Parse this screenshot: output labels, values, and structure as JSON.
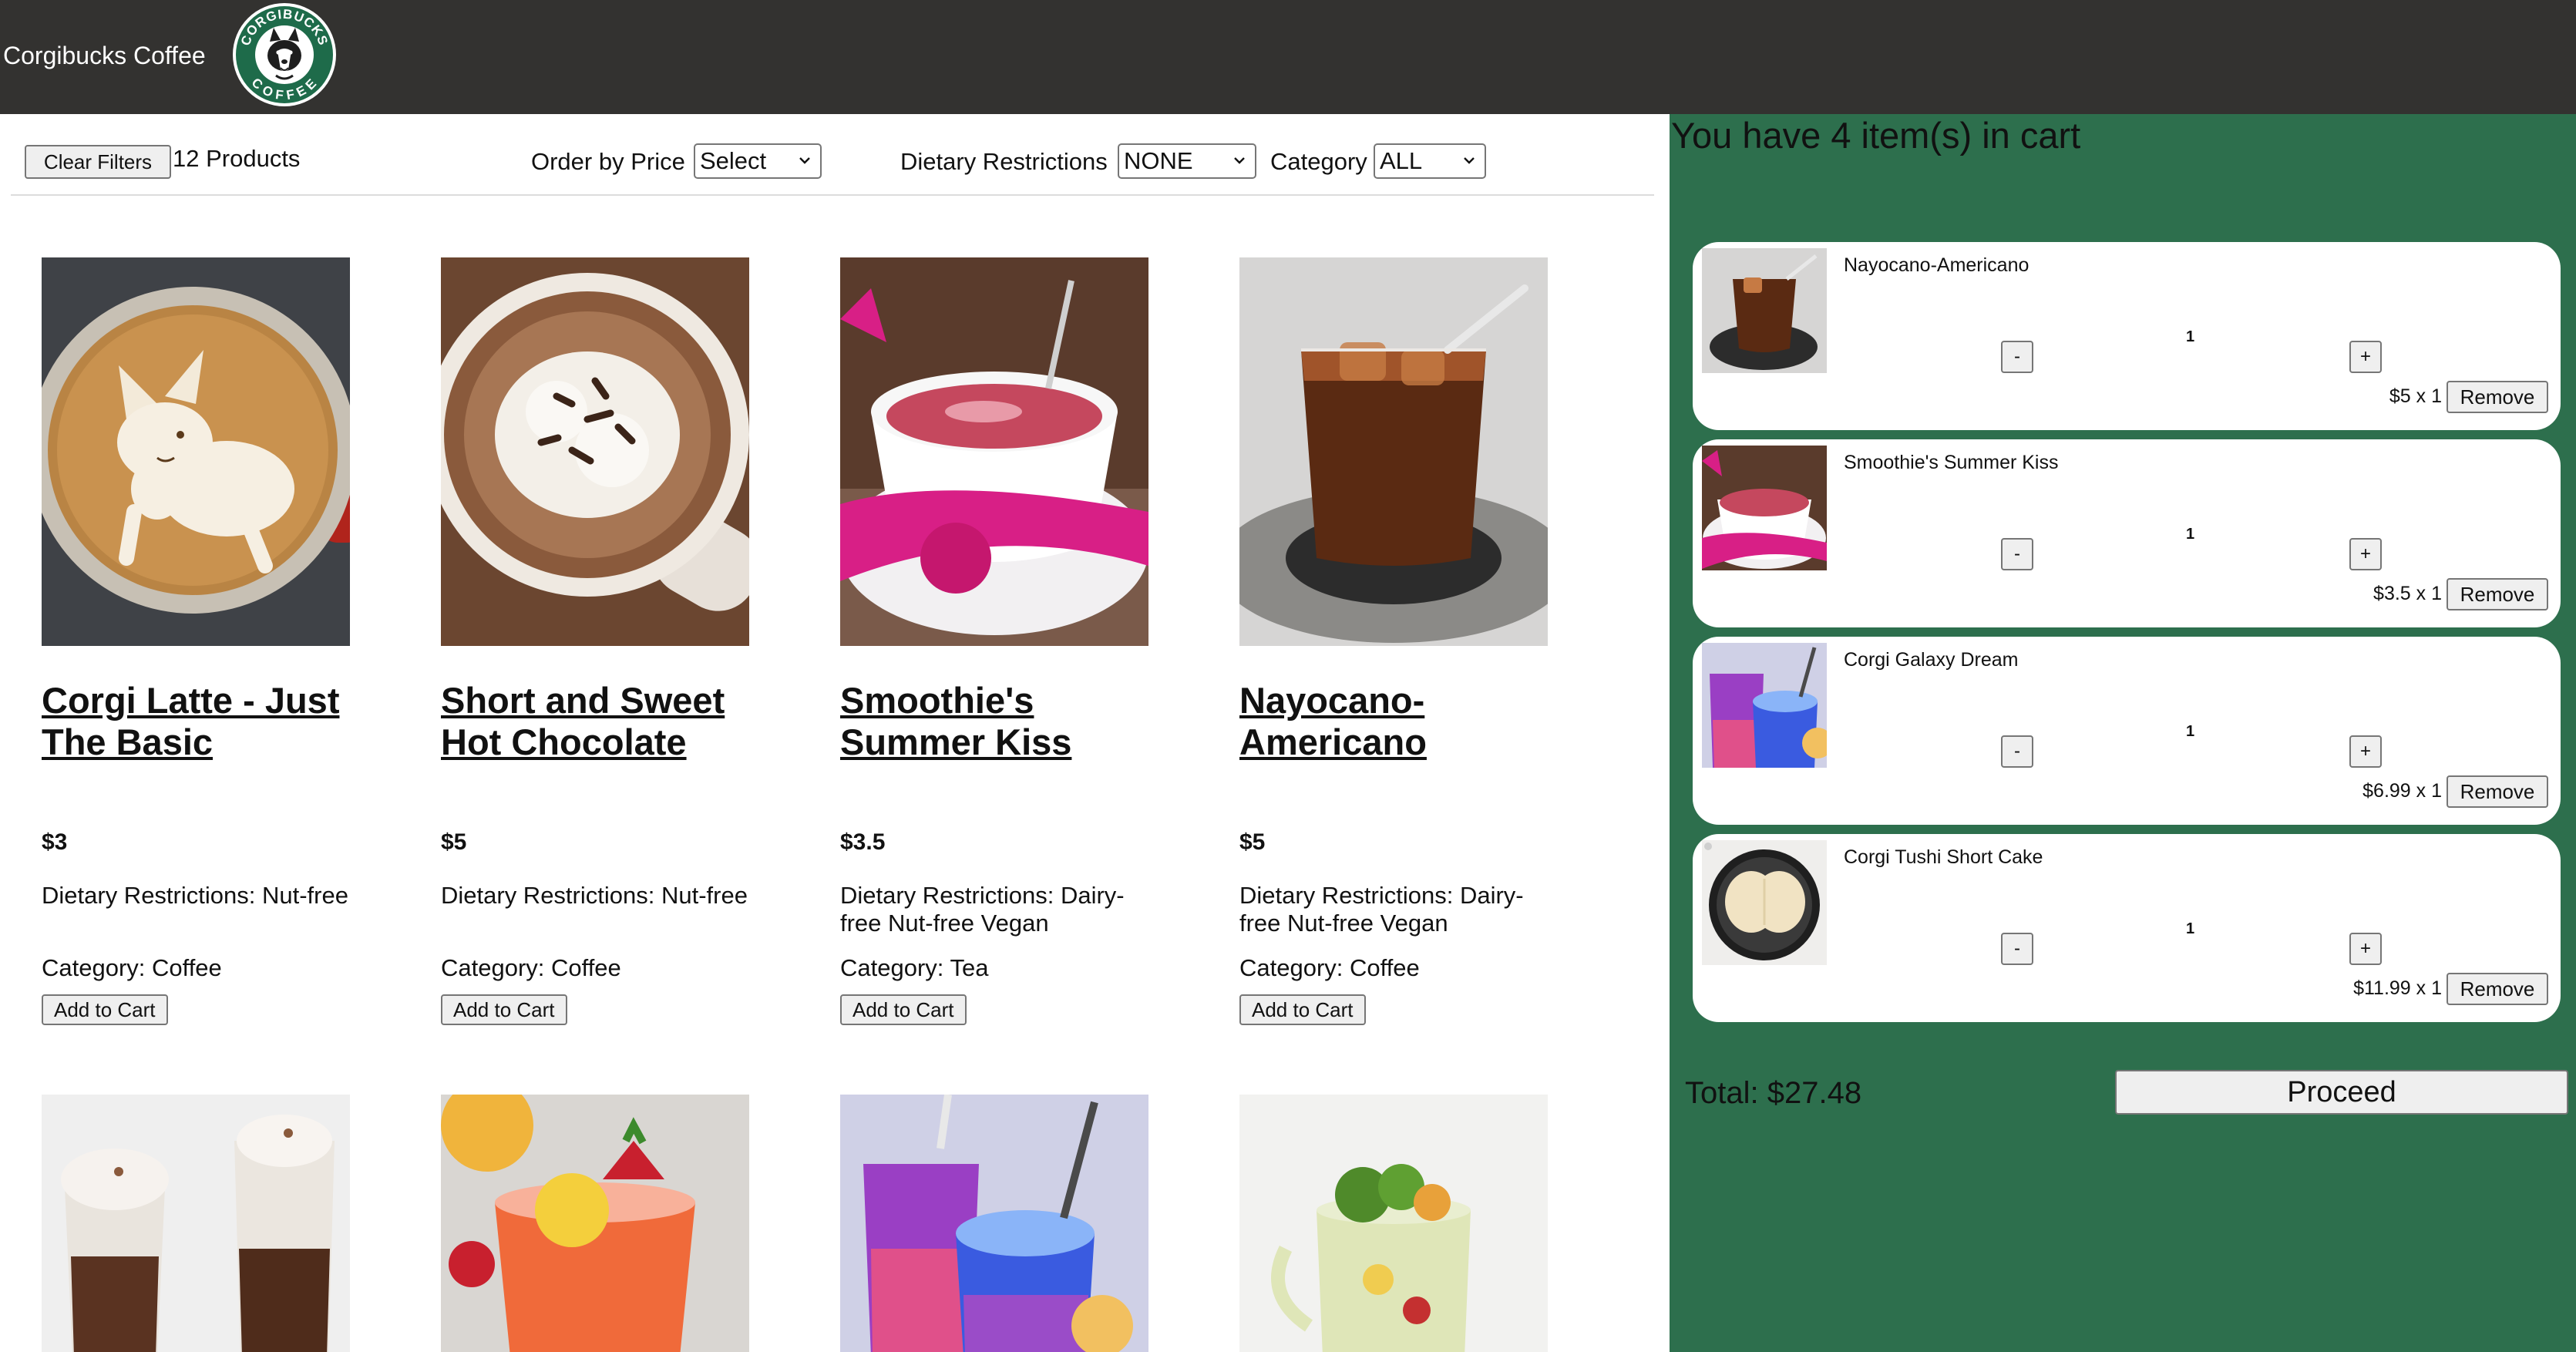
{
  "header": {
    "brand": "Corgibucks Coffee",
    "logo_text_top": "CORGIBUCKS",
    "logo_text_bottom": "COFFEE"
  },
  "filters": {
    "clear_label": "Clear Filters",
    "count_label": "12 Products",
    "order_label": "Order by Price",
    "order_value": "Select",
    "diet_label": "Dietary Restrictions",
    "diet_value": "NONE",
    "category_label": "Category",
    "category_value": "ALL"
  },
  "products": [
    {
      "title": "Corgi Latte - Just The Basic",
      "price": "$3",
      "diet": "Dietary Restrictions: Nut-free",
      "category": "Category: Coffee",
      "add_label": "Add to Cart",
      "image": "corgi-latte-art"
    },
    {
      "title": "Short and Sweet Hot Chocolate",
      "price": "$5",
      "diet": "Dietary Restrictions: Nut-free",
      "category": "Category: Coffee",
      "add_label": "Add to Cart",
      "image": "hot-chocolate"
    },
    {
      "title": "Smoothie's Summer Kiss",
      "price": "$3.5",
      "diet": "Dietary Restrictions: Dairy-free Nut-free Vegan",
      "category": "Category: Tea",
      "add_label": "Add to Cart",
      "image": "pink-tea-cup"
    },
    {
      "title": "Nayocano-Americano",
      "price": "$5",
      "diet": "Dietary Restrictions: Dairy-free Nut-free Vegan",
      "category": "Category: Coffee",
      "add_label": "Add to Cart",
      "image": "iced-americano"
    }
  ],
  "products_row2_images": [
    "layered-hot-chocolate",
    "strawberry-lemonade",
    "galaxy-drink",
    "mojito-jar"
  ],
  "cart": {
    "heading": "You have 4 item(s) in cart",
    "items": [
      {
        "name": "Nayocano-Americano",
        "qty": "1",
        "price": "$5 x 1",
        "minus": "-",
        "plus": "+",
        "remove": "Remove",
        "image": "iced-americano"
      },
      {
        "name": "Smoothie's Summer Kiss",
        "qty": "1",
        "price": "$3.5 x 1",
        "minus": "-",
        "plus": "+",
        "remove": "Remove",
        "image": "pink-tea-cup"
      },
      {
        "name": "Corgi Galaxy Dream",
        "qty": "1",
        "price": "$6.99 x 1",
        "minus": "-",
        "plus": "+",
        "remove": "Remove",
        "image": "galaxy-drink"
      },
      {
        "name": "Corgi Tushi Short Cake",
        "qty": "1",
        "price": "$11.99 x 1",
        "minus": "-",
        "plus": "+",
        "remove": "Remove",
        "image": "corgi-cake"
      }
    ],
    "total": "Total: $27.48",
    "proceed_label": "Proceed"
  },
  "colors": {
    "header_bg": "#333230",
    "cart_bg": "#2d6f4d",
    "logo_green": "#1e6b4a"
  }
}
